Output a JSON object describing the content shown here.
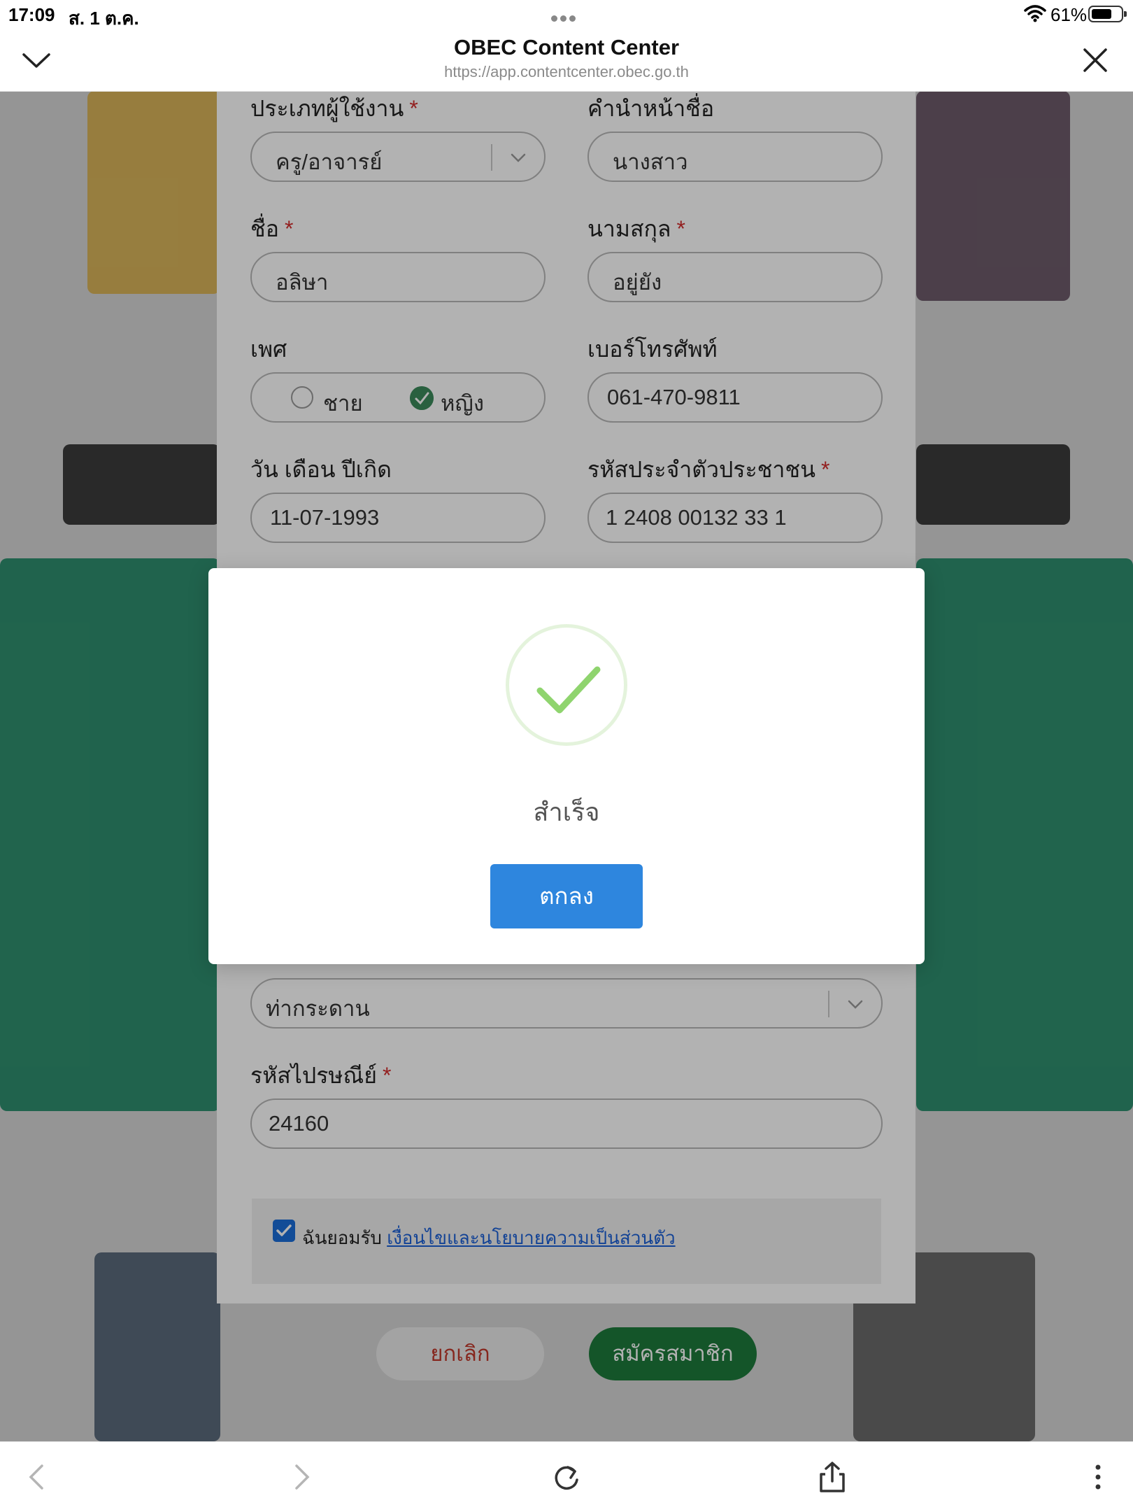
{
  "status_bar": {
    "time": "17:09",
    "date": "ส. 1 ต.ค.",
    "battery_percent": "61%"
  },
  "header": {
    "title": "OBEC Content Center",
    "url": "https://app.contentcenter.obec.go.th"
  },
  "form": {
    "user_type": {
      "label": "ประเภทผู้ใช้งาน",
      "required_mark": "*",
      "value": "ครู/อาจารย์"
    },
    "prefix": {
      "label": "คำนำหน้าชื่อ",
      "value": "นางสาว"
    },
    "first_name": {
      "label": "ชื่อ",
      "required_mark": "*",
      "value": "อลิษา"
    },
    "last_name": {
      "label": "นามสกุล",
      "required_mark": "*",
      "value": "อยู่ยัง"
    },
    "gender": {
      "label": "เพศ",
      "option_male": "ชาย",
      "option_female": "หญิง",
      "selected": "หญิง"
    },
    "phone": {
      "label": "เบอร์โทรศัพท์",
      "value": "061-470-9811"
    },
    "birthdate": {
      "label": "วัน เดือน ปีเกิด",
      "value": "11-07-1993"
    },
    "citizen_id": {
      "label": "รหัสประจำตัวประชาชน",
      "required_mark": "*",
      "value": "1 2408 00132 33 1"
    },
    "subdistrict": {
      "value": "ท่ากระดาน"
    },
    "postal_code": {
      "label": "รหัสไปรษณีย์",
      "required_mark": "*",
      "value": "24160"
    },
    "terms": {
      "prefix": "ฉันยอมรับ",
      "link_text": "เงื่อนไขและนโยบายความเป็นส่วนตัว",
      "checked": true
    }
  },
  "actions": {
    "cancel_label": "ยกเลิก",
    "signup_label": "สมัครสมาชิก"
  },
  "modal": {
    "icon": "success-check-icon",
    "title": "สำเร็จ",
    "ok_label": "ตกลง"
  },
  "toolbar": {
    "items": [
      "back-icon",
      "forward-icon",
      "reload-icon",
      "share-icon",
      "more-icon"
    ]
  },
  "colors": {
    "primary": "#2e86de",
    "success": "#8fd46e",
    "signup": "#1e7a3c",
    "cancel_text": "#c0392b",
    "required": "#d32f2f"
  }
}
